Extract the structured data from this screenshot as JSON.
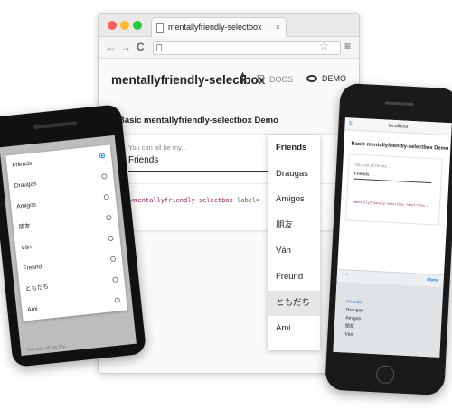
{
  "browser": {
    "tab_title": "mentallyfriendly-selectbox",
    "close_glyph": "×",
    "back_glyph": "←",
    "forward_glyph": "→",
    "reload_glyph": "C",
    "star_glyph": "☆",
    "menu_glyph": "≡",
    "traffic_colors": [
      "#ff5f57",
      "#febc2e",
      "#28c840"
    ]
  },
  "app": {
    "title": "mentallyfriendly-selectbox",
    "docs_label": "DOCS",
    "demo_label": "DEMO",
    "card_title": "Basic mentallyfriendly-selectbox Demo",
    "field_placeholder": "You can all be my...",
    "field_value": "Friends",
    "code_tag": "<mentallyfriendly-selectbox",
    "code_attr": "label=",
    "code_cut": "be"
  },
  "dropdown": {
    "options": [
      "Friends",
      "Draugas",
      "Amigos",
      "朋友",
      "Vän",
      "Freund",
      "ともだち",
      "Ami"
    ],
    "selected": "Friends",
    "highlighted": "ともだち"
  },
  "android": {
    "options": [
      "Friends",
      "Draugas",
      "Amigos",
      "朋友",
      "Vän",
      "Freund",
      "ともだち",
      "Ami"
    ],
    "selected": "Friends",
    "field_hint": "You can all be my...",
    "accent": "#2d7fd6"
  },
  "iphone": {
    "url": "localhost",
    "card_title": "Basic mentallyfriendly-selectbox Demo",
    "field_placeholder": "You can all be my...",
    "field_value": "Friends",
    "code": "<mentallyfriendly-selectbox label=\"You c",
    "done_label": "Done",
    "picker_options": [
      "Friends",
      "Draugas",
      "Amigos",
      "朋友",
      "Vän"
    ],
    "picker_selected": "Friends"
  }
}
